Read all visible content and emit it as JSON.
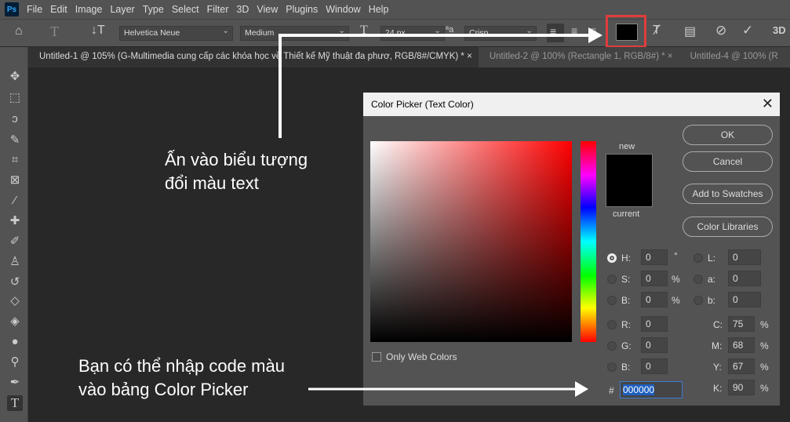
{
  "menu": {
    "logo": "Ps",
    "items": [
      "File",
      "Edit",
      "Image",
      "Layer",
      "Type",
      "Select",
      "Filter",
      "3D",
      "View",
      "Plugins",
      "Window",
      "Help"
    ]
  },
  "options": {
    "font_family": "Helvetica Neue",
    "font_style": "Medium",
    "font_size": "24 px",
    "antialias": "Crisp",
    "aa_icon": "ªa",
    "threed": "3D",
    "text_color": "#000000",
    "highlight_color": "#e03c3c"
  },
  "tabs": [
    "Untitled-1 @ 105% (G-Multimedia cung cấp các khóa học về Thiết kế Mỹ thuật đa phươ, RGB/8#/CMYK) *",
    "Untitled-2 @ 100% (Rectangle 1, RGB/8#) *",
    "Untitled-4 @ 100% (R"
  ],
  "dialog": {
    "title": "Color Picker (Text Color)",
    "new_label": "new",
    "current_label": "current",
    "buttons": {
      "ok": "OK",
      "cancel": "Cancel",
      "add": "Add to Swatches",
      "libraries": "Color Libraries"
    },
    "only_web": "Only Web Colors",
    "hsb": [
      {
        "l": "H:",
        "v": "0",
        "u": "°"
      },
      {
        "l": "S:",
        "v": "0",
        "u": "%"
      },
      {
        "l": "B:",
        "v": "0",
        "u": "%"
      }
    ],
    "lab": [
      {
        "l": "L:",
        "v": "0"
      },
      {
        "l": "a:",
        "v": "0"
      },
      {
        "l": "b:",
        "v": "0"
      }
    ],
    "rgb": [
      {
        "l": "R:",
        "v": "0"
      },
      {
        "l": "G:",
        "v": "0"
      },
      {
        "l": "B:",
        "v": "0"
      }
    ],
    "cmyk": [
      {
        "l": "C:",
        "v": "75",
        "u": "%"
      },
      {
        "l": "M:",
        "v": "68",
        "u": "%"
      },
      {
        "l": "Y:",
        "v": "67",
        "u": "%"
      },
      {
        "l": "K:",
        "v": "90",
        "u": "%"
      }
    ],
    "hex_label": "#",
    "hex": "000000",
    "selected_radio": "H"
  },
  "annotations": {
    "top_line1": "Ấn vào biểu tượng",
    "top_line2": "đổi màu text",
    "bottom_line1": "Bạn có thể nhập code màu",
    "bottom_line2": "vào bảng Color Picker"
  }
}
